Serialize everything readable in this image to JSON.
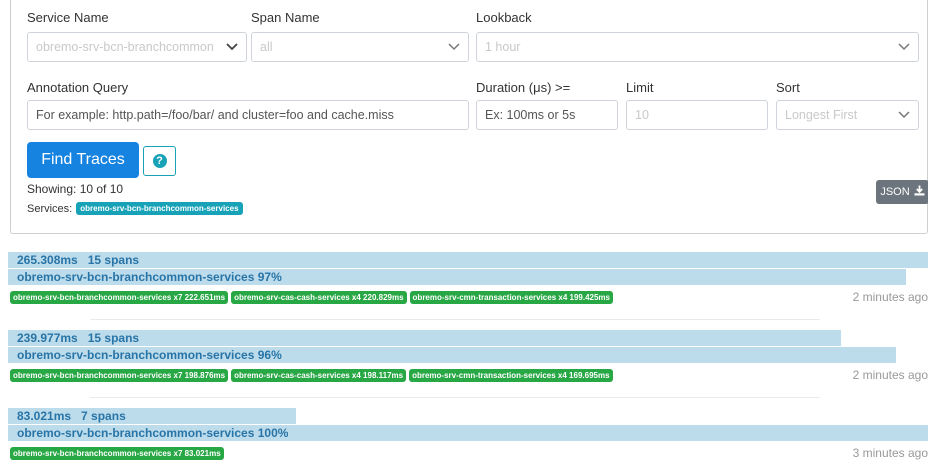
{
  "form": {
    "service_name_label": "Service Name",
    "service_name_value": "obremo-srv-bcn-branchcommon",
    "span_name_label": "Span Name",
    "span_name_value": "all",
    "lookback_label": "Lookback",
    "lookback_value": "1 hour",
    "annotation_label": "Annotation Query",
    "annotation_placeholder": "For example: http.path=/foo/bar/ and cluster=foo and cache.miss",
    "duration_label": "Duration (μs) >=",
    "duration_placeholder": "Ex: 100ms or 5s",
    "limit_label": "Limit",
    "limit_value": "10",
    "sort_label": "Sort",
    "sort_value": "Longest First",
    "find_button": "Find Traces",
    "help_glyph": "?",
    "json_button": "JSON",
    "showing": "Showing: 10 of 10",
    "services_label": "Services:",
    "services_badge": "obremo-srv-bcn-branchcommon-services"
  },
  "traces": [
    {
      "duration": "265.308ms",
      "spans": "15 spans",
      "duration_fill": 1.0,
      "root": "obremo-srv-bcn-branchcommon-services 97%",
      "root_fill": 0.97,
      "chips": [
        "obremo-srv-bcn-branchcommon-services x7 222.651ms",
        "obremo-srv-cas-cash-services x4 220.829ms",
        "obremo-srv-cmn-transaction-services x4 199.425ms"
      ],
      "ago": "2 minutes ago"
    },
    {
      "duration": "239.977ms",
      "spans": "15 spans",
      "duration_fill": 0.905,
      "root": "obremo-srv-bcn-branchcommon-services 96%",
      "root_fill": 0.96,
      "chips": [
        "obremo-srv-bcn-branchcommon-services x7 198.876ms",
        "obremo-srv-cas-cash-services x4 198.117ms",
        "obremo-srv-cmn-transaction-services x4 169.695ms"
      ],
      "ago": "2 minutes ago"
    },
    {
      "duration": "83.021ms",
      "spans": "7 spans",
      "duration_fill": 0.313,
      "root": "obremo-srv-bcn-branchcommon-services 100%",
      "root_fill": 1.0,
      "chips": [
        "obremo-srv-bcn-branchcommon-services x7 83.021ms"
      ],
      "ago": "3 minutes ago"
    }
  ]
}
